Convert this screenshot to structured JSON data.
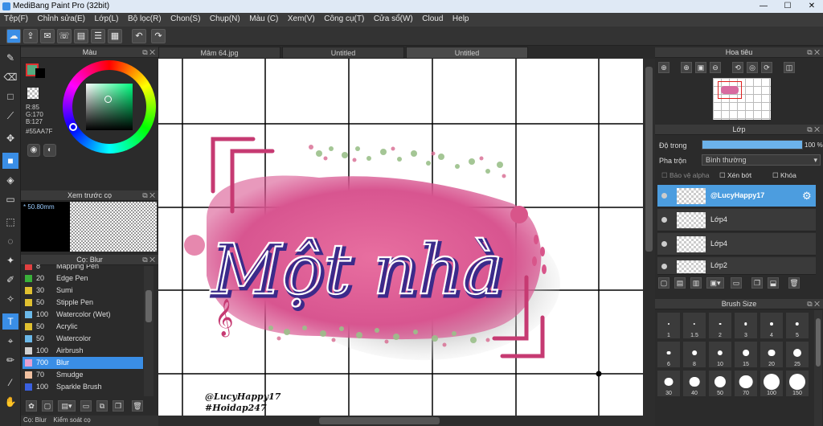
{
  "window": {
    "title": "MediBang Paint Pro (32bit)",
    "minimize": "—",
    "maximize": "☐",
    "close": "✕"
  },
  "menu": [
    "Tệp(F)",
    "Chỉnh sửa(E)",
    "Lớp(L)",
    "Bộ lọc(R)",
    "Chon(S)",
    "Chụp(N)",
    "Màu (C)",
    "Xem(V)",
    "Công cụ(T)",
    "Cửa sổ(W)",
    "Cloud",
    "Help"
  ],
  "color_panel": {
    "title": "Màu",
    "r": "R:85",
    "g": "G:170",
    "b": "B:127",
    "hex": "#55AA7F",
    "current_color": "#55aa7f",
    "wheel_center_color": "#2d4a3c"
  },
  "preview_panel": {
    "title": "Xem trước cọ",
    "size": "50.80mm"
  },
  "brush_panel": {
    "title": "Cọ: Blur",
    "items": [
      {
        "size": "8",
        "name": "Mapping Pen",
        "color": "#e04040"
      },
      {
        "size": "20",
        "name": "Edge Pen",
        "color": "#3ab03a"
      },
      {
        "size": "30",
        "name": "Sumi",
        "color": "#e0c030"
      },
      {
        "size": "50",
        "name": "Stipple Pen",
        "color": "#e0c030"
      },
      {
        "size": "100",
        "name": "Watercolor (Wet)",
        "color": "#6ab8e8"
      },
      {
        "size": "50",
        "name": "Acrylic",
        "color": "#e0c030"
      },
      {
        "size": "50",
        "name": "Watercolor",
        "color": "#6ab8e8"
      },
      {
        "size": "100",
        "name": "Airbrush",
        "color": "#d0d0d0"
      },
      {
        "size": "700",
        "name": "Blur",
        "color": "#e8a0d0"
      },
      {
        "size": "70",
        "name": "Smudge",
        "color": "#f0c0a0"
      },
      {
        "size": "100",
        "name": "Sparkle Brush",
        "color": "#3a60e0"
      }
    ],
    "selected_index": 8
  },
  "bottom_tabs": [
    "Cọ: Blur",
    "Kiểm soát cọ"
  ],
  "doc_tabs": [
    "Mâm 64.jpg",
    "Untitled",
    "Untitled"
  ],
  "active_doc_tab": 2,
  "artwork": {
    "main_text": "Một nhà",
    "watermark_line1": "@LucyHappy17",
    "watermark_line2": "#Hoidap247"
  },
  "navigator": {
    "title": "Hoa tiêu"
  },
  "layer_panel": {
    "title": "Lớp",
    "opacity_label": "Độ trong",
    "opacity_value": "100 %",
    "opacity_percent": 100,
    "blend_label": "Pha trộn",
    "blend_value": "Bình thường",
    "protect_alpha": "Bảo vệ alpha",
    "clipping": "Xén bớt",
    "lock": "Khóa",
    "layers": [
      {
        "name": "@LucyHappy17",
        "selected": true
      },
      {
        "name": "Lớp4",
        "selected": false
      },
      {
        "name": "Lớp4",
        "selected": false
      },
      {
        "name": "Lớp2",
        "selected": false
      }
    ]
  },
  "brush_size_panel": {
    "title": "Brush Size",
    "sizes": [
      "1",
      "1.5",
      "2",
      "3",
      "4",
      "5",
      "6",
      "8",
      "10",
      "15",
      "20",
      "25",
      "30",
      "40",
      "50",
      "70",
      "100",
      "150"
    ]
  }
}
